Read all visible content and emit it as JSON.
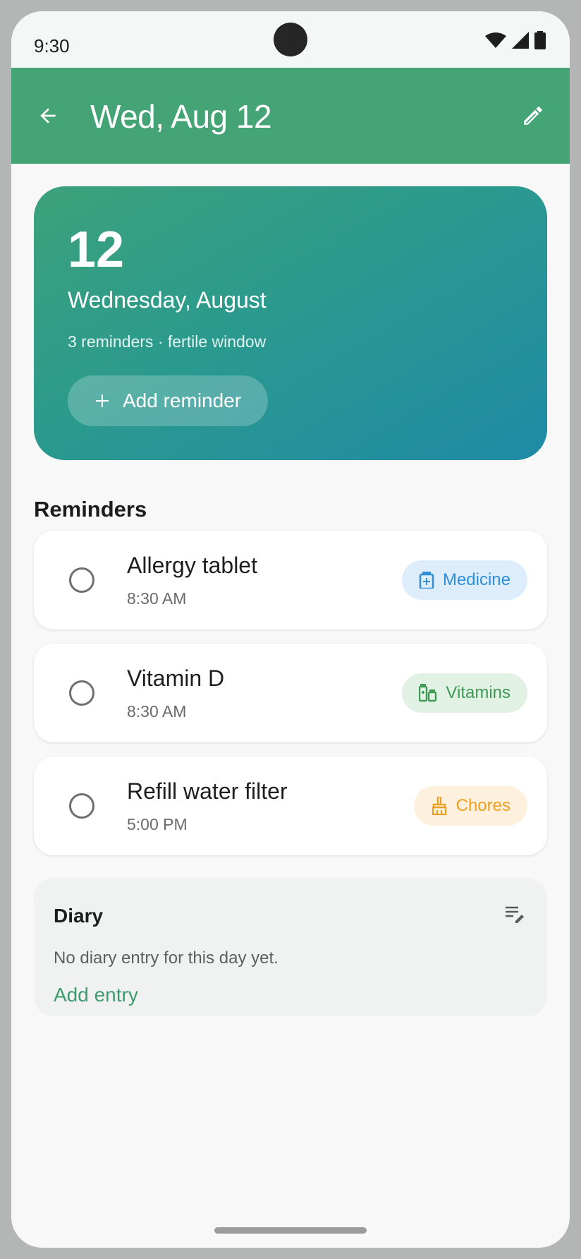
{
  "status_bar": {
    "time": "9:30"
  },
  "app_bar": {
    "title": "Wed, Aug 12",
    "back_icon": "arrow-back-icon",
    "edit_icon": "pencil-icon"
  },
  "hero": {
    "day_number": "12",
    "date_line": "Wednesday, August",
    "meta": "3 reminders · fertile window",
    "add_button_label": "Add reminder"
  },
  "reminders": {
    "section_title": "Reminders",
    "items": [
      {
        "title": "Allergy tablet",
        "time": "8:30 AM",
        "category": "Medicine",
        "category_icon": "medicine-box-icon",
        "color": "#2f8fd8",
        "bg": "#ddedfb"
      },
      {
        "title": "Vitamin D",
        "time": "8:30 AM",
        "category": "Vitamins",
        "category_icon": "vitamins-bottles-icon",
        "color": "#3e9a54",
        "bg": "#e1f2e4"
      },
      {
        "title": "Refill water filter",
        "time": "5:00 PM",
        "category": "Chores",
        "category_icon": "broom-icon",
        "color": "#ee9f1f",
        "bg": "#fdf0dc"
      }
    ]
  },
  "diary": {
    "title": "Diary",
    "empty_text": "No diary entry for this day yet.",
    "add_label": "Add entry",
    "icon": "notes-edit-icon"
  },
  "colors": {
    "app_bar": "#45a475",
    "accent_text": "#3e9b6d"
  }
}
